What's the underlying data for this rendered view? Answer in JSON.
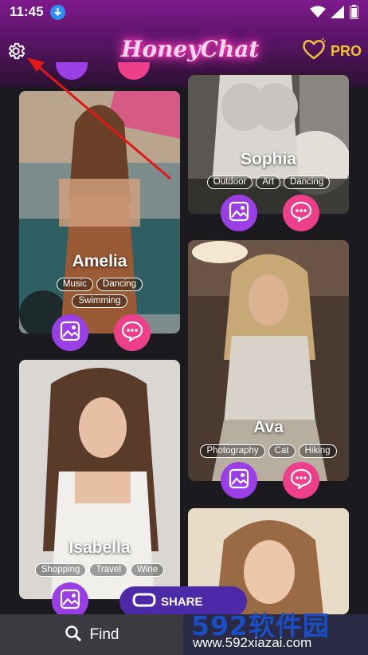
{
  "status": {
    "time": "11:45",
    "icons": [
      "download-icon",
      "wifi-icon",
      "signal-icon",
      "battery-icon"
    ]
  },
  "header": {
    "logo_text": "HoneyChat",
    "pro_label": "PRO",
    "icons": [
      "gear-icon",
      "heart-icon"
    ]
  },
  "cards": [
    {
      "name": "Sophia",
      "tags": [
        "Outdoor",
        "Art",
        "Dancing"
      ]
    },
    {
      "name": "Amelia",
      "tags": [
        "Music",
        "Dancing",
        "Swimming"
      ]
    },
    {
      "name": "Ava",
      "tags": [
        "Photography",
        "Cat",
        "Hiking"
      ]
    },
    {
      "name": "Isabella",
      "tags": [
        "Shopping",
        "Travel",
        "Wine"
      ]
    }
  ],
  "bottom_nav": {
    "find_label": "Find",
    "share_label": "SHARE"
  },
  "watermark": {
    "main": "592软件园",
    "sub": "www.592xiazai.com"
  },
  "colors": {
    "accent_pink": "#ee3f8a",
    "accent_purple": "#9a3ee6",
    "pro_gold": "#f2c236"
  }
}
